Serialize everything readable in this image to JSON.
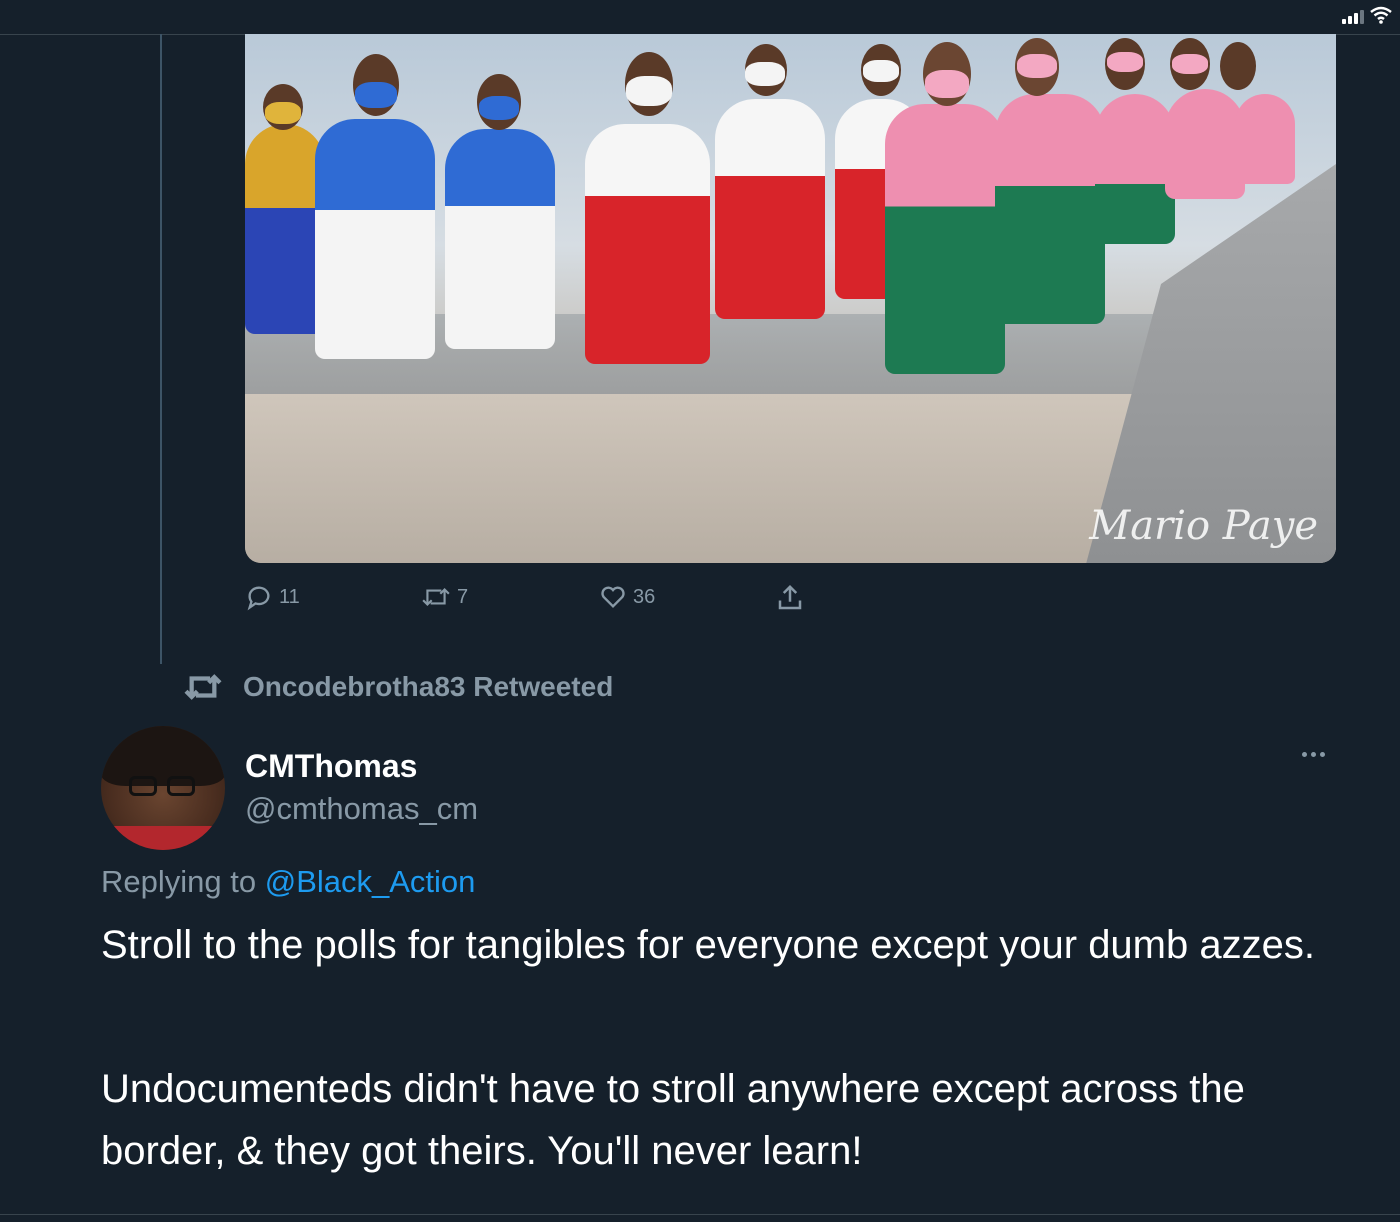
{
  "colors": {
    "background": "#15202b",
    "secondary_text": "#8899a6",
    "link": "#1d9bf0",
    "divider": "#38444d"
  },
  "media": {
    "watermark": "Mario Paye"
  },
  "actions": {
    "reply_count": "11",
    "retweet_count": "7",
    "like_count": "36",
    "icons": [
      "reply-icon",
      "retweet-icon",
      "like-icon",
      "share-icon"
    ]
  },
  "retweet_header": {
    "text": "Oncodebrotha83 Retweeted"
  },
  "tweet": {
    "display_name": "CMThomas",
    "handle": "@cmthomas_cm",
    "replying_prefix": "Replying to ",
    "replying_to": "@Black_Action",
    "paragraph_1": "Stroll to the polls for tangibles for everyone except your dumb azzes.",
    "paragraph_2": "Undocumenteds didn't have to stroll anywhere except across the border, & they got theirs. You'll never learn!"
  }
}
